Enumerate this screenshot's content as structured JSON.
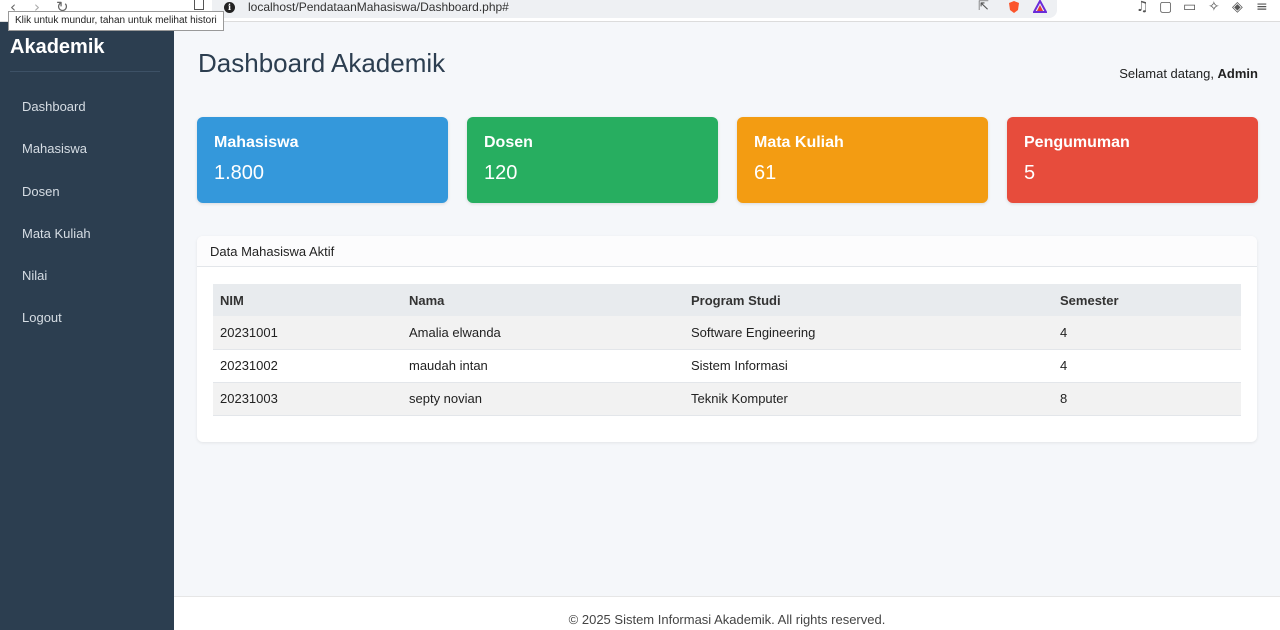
{
  "browser": {
    "url": "localhost/PendataanMahasiswa/Dashboard.php#",
    "tooltip": "Klik untuk mundur, tahan untuk melihat histori"
  },
  "sidebar": {
    "brand": "Akademik",
    "items": [
      {
        "label": "Dashboard"
      },
      {
        "label": "Mahasiswa"
      },
      {
        "label": "Dosen"
      },
      {
        "label": "Mata Kuliah"
      },
      {
        "label": "Nilai"
      },
      {
        "label": "Logout"
      }
    ]
  },
  "header": {
    "title": "Dashboard Akademik",
    "welcome_prefix": "Selamat datang, ",
    "user": "Admin"
  },
  "cards": [
    {
      "title": "Mahasiswa",
      "value": "1.800",
      "color": "#3498db"
    },
    {
      "title": "Dosen",
      "value": "120",
      "color": "#27ae60"
    },
    {
      "title": "Mata Kuliah",
      "value": "61",
      "color": "#f39c12"
    },
    {
      "title": "Pengumuman",
      "value": "5",
      "color": "#e74c3c"
    }
  ],
  "table_panel": {
    "title": "Data Mahasiswa Aktif",
    "columns": [
      "NIM",
      "Nama",
      "Program Studi",
      "Semester"
    ],
    "rows": [
      [
        "20231001",
        "Amalia elwanda",
        "Software Engineering",
        "4"
      ],
      [
        "20231002",
        "maudah intan",
        "Sistem Informasi",
        "4"
      ],
      [
        "20231003",
        "septy novian",
        "Teknik Komputer",
        "8"
      ]
    ]
  },
  "footer": {
    "text": "© 2025 Sistem Informasi Akademik. All rights reserved."
  }
}
